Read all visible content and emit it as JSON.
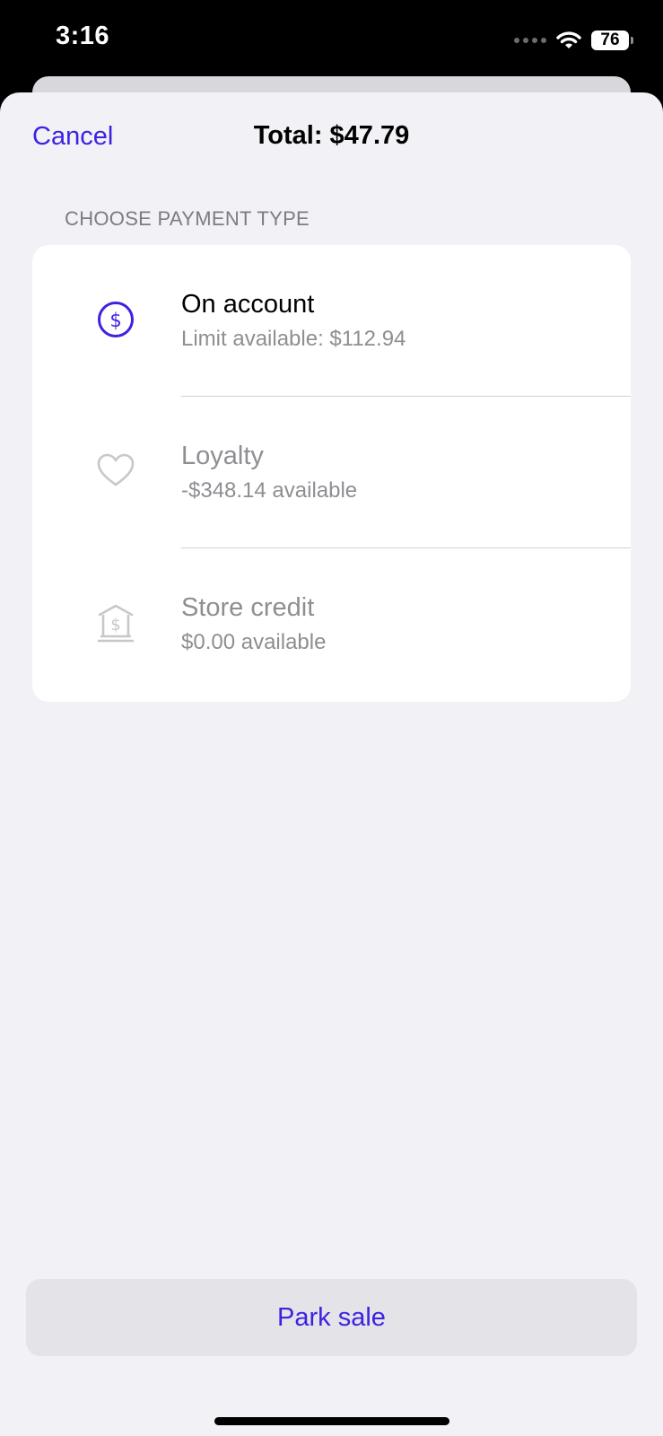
{
  "status_bar": {
    "time": "3:16",
    "battery": "76"
  },
  "header": {
    "cancel_label": "Cancel",
    "total": "Total: $47.79"
  },
  "payment": {
    "section_title": "CHOOSE PAYMENT TYPE",
    "options": [
      {
        "title": "On account",
        "subtitle": "Limit available: $112.94",
        "icon": "dollar-circle-icon",
        "enabled": true
      },
      {
        "title": "Loyalty",
        "subtitle": "-$348.14 available",
        "icon": "heart-icon",
        "enabled": false
      },
      {
        "title": "Store credit",
        "subtitle": "$0.00 available",
        "icon": "bank-dollar-icon",
        "enabled": false
      }
    ]
  },
  "footer": {
    "park_label": "Park sale"
  },
  "colors": {
    "accent": "#3d22e0",
    "sheet_background": "#f1f1f6",
    "disabled_text": "#8e8e93"
  }
}
